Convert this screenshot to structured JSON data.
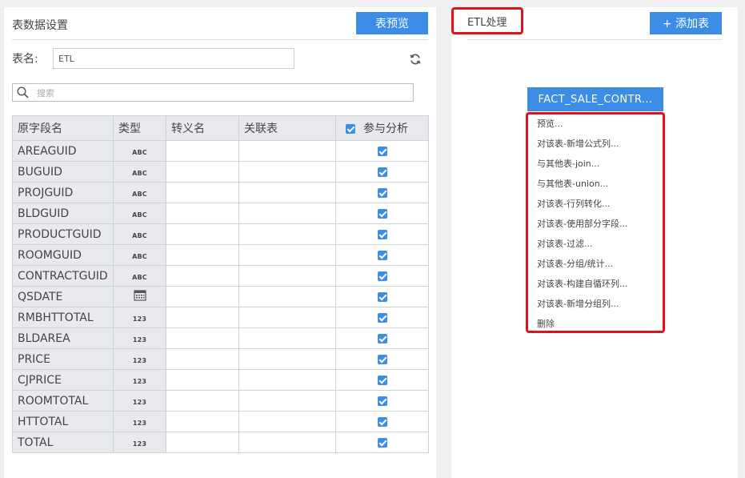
{
  "left": {
    "title": "表数据设置",
    "preview_button": "表预览",
    "name_label": "表名:",
    "name_value": "ETL",
    "search_placeholder": "搜索",
    "columns": [
      "原字段名",
      "类型",
      "转义名",
      "关联表",
      "参与分析"
    ],
    "rows": [
      {
        "name": "AREAGUID",
        "type": "ABC",
        "alias": "",
        "link": "",
        "checked": true
      },
      {
        "name": "BUGUID",
        "type": "ABC",
        "alias": "",
        "link": "",
        "checked": true
      },
      {
        "name": "PROJGUID",
        "type": "ABC",
        "alias": "",
        "link": "",
        "checked": true
      },
      {
        "name": "BLDGUID",
        "type": "ABC",
        "alias": "",
        "link": "",
        "checked": true
      },
      {
        "name": "PRODUCTGUID",
        "type": "ABC",
        "alias": "",
        "link": "",
        "checked": true
      },
      {
        "name": "ROOMGUID",
        "type": "ABC",
        "alias": "",
        "link": "",
        "checked": true
      },
      {
        "name": "CONTRACTGUID",
        "type": "ABC",
        "alias": "",
        "link": "",
        "checked": true
      },
      {
        "name": "QSDATE",
        "type": "calendar-icon",
        "alias": "",
        "link": "",
        "checked": true
      },
      {
        "name": "RMBHTTOTAL",
        "type": "123",
        "alias": "",
        "link": "",
        "checked": true
      },
      {
        "name": "BLDAREA",
        "type": "123",
        "alias": "",
        "link": "",
        "checked": true
      },
      {
        "name": "PRICE",
        "type": "123",
        "alias": "",
        "link": "",
        "checked": true
      },
      {
        "name": "CJPRICE",
        "type": "123",
        "alias": "",
        "link": "",
        "checked": true
      },
      {
        "name": "ROOMTOTAL",
        "type": "123",
        "alias": "",
        "link": "",
        "checked": true
      },
      {
        "name": "HTTOTAL",
        "type": "123",
        "alias": "",
        "link": "",
        "checked": true
      },
      {
        "name": "TOTAL",
        "type": "123",
        "alias": "",
        "link": "",
        "checked": true
      }
    ]
  },
  "right": {
    "tab_label": "ETL处理",
    "add_table_button": "+ 添加表",
    "table_node": "FACT_SALE_CONTR...",
    "menu": [
      "预览...",
      "对该表-新增公式列...",
      "与其他表-join...",
      "与其他表-union...",
      "对该表-行列转化...",
      "对该表-使用部分字段...",
      "对该表-过滤...",
      "对该表-分组/统计...",
      "对该表-构建自循环列...",
      "对该表-新增分组列...",
      "删除"
    ]
  },
  "colors": {
    "accent": "#3b8de6",
    "highlight": "#e0121b",
    "header_bg": "#e8eaee"
  }
}
